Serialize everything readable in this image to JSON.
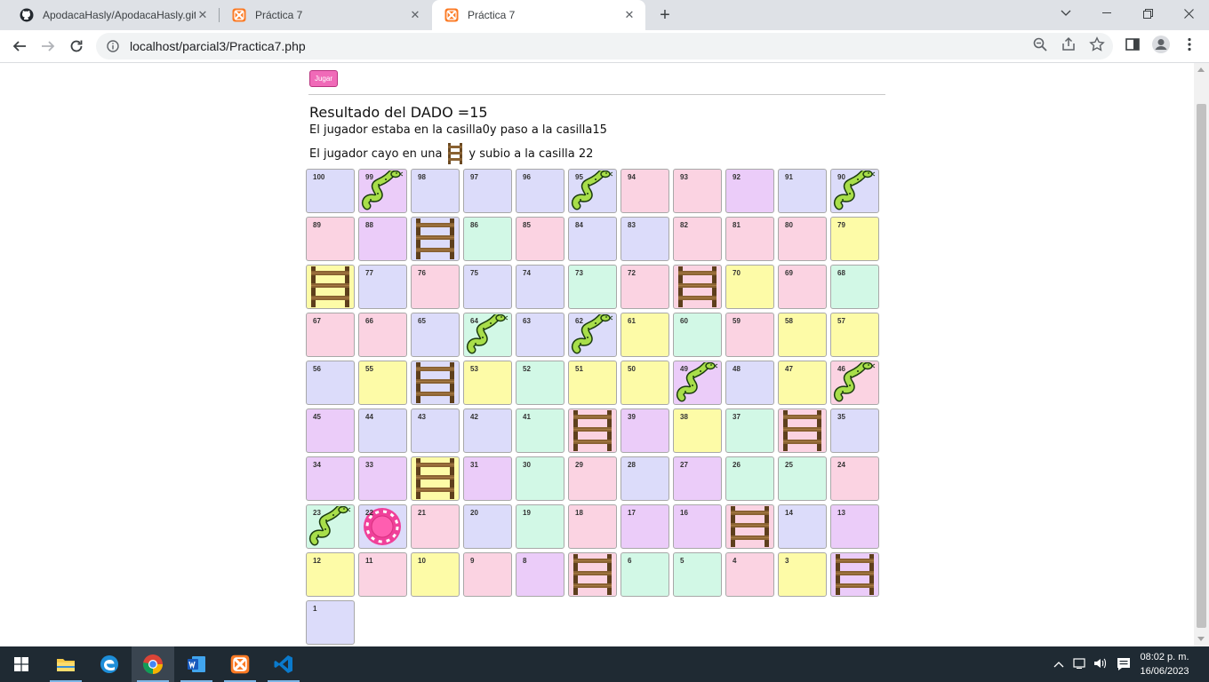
{
  "browser": {
    "tabs": [
      {
        "title": "ApodacaHasly/ApodacaHasly.git",
        "icon": "github-icon",
        "active": false
      },
      {
        "title": "Práctica 7",
        "icon": "xampp-icon",
        "active": false
      },
      {
        "title": "Práctica 7",
        "icon": "xampp-icon",
        "active": true
      }
    ],
    "url": "localhost/parcial3/Practica7.php"
  },
  "page": {
    "button_label": "Jugar",
    "result_heading": "Resultado del DADO =15",
    "move_text": "El jugador estaba en la casilla0y paso a la casilla15",
    "ladder_text_before": "El jugador cayo en una",
    "ladder_text_after": "y subio a la casilla 22"
  },
  "colors": {
    "lavender": "#dcdcfa",
    "pink": "#fbd3e2",
    "purple": "#ebccf9",
    "mint": "#d2f8e6",
    "yellow": "#fdfba7",
    "button": "#f06ab8",
    "token": "#f0409a"
  },
  "board": {
    "rows": [
      [
        {
          "n": "100",
          "c": "lavender"
        },
        {
          "n": "99",
          "c": "purple",
          "a": "snake"
        },
        {
          "n": "98",
          "c": "lavender"
        },
        {
          "n": "97",
          "c": "lavender"
        },
        {
          "n": "96",
          "c": "lavender"
        },
        {
          "n": "95",
          "c": "lavender",
          "a": "snake"
        },
        {
          "n": "94",
          "c": "pink"
        },
        {
          "n": "93",
          "c": "pink"
        },
        {
          "n": "92",
          "c": "purple"
        },
        {
          "n": "91",
          "c": "lavender"
        },
        {
          "n": "90",
          "c": "lavender",
          "a": "snake"
        }
      ],
      [
        {
          "n": "89",
          "c": "pink"
        },
        {
          "n": "88",
          "c": "purple"
        },
        {
          "n": "",
          "c": "lavender",
          "a": "ladder"
        },
        {
          "n": "86",
          "c": "mint"
        },
        {
          "n": "85",
          "c": "pink"
        },
        {
          "n": "84",
          "c": "lavender"
        },
        {
          "n": "83",
          "c": "lavender"
        },
        {
          "n": "82",
          "c": "pink"
        },
        {
          "n": "81",
          "c": "pink"
        },
        {
          "n": "80",
          "c": "pink"
        },
        {
          "n": "79",
          "c": "yellow"
        }
      ],
      [
        {
          "n": "",
          "c": "yellow",
          "a": "ladder"
        },
        {
          "n": "77",
          "c": "lavender"
        },
        {
          "n": "76",
          "c": "pink"
        },
        {
          "n": "75",
          "c": "lavender"
        },
        {
          "n": "74",
          "c": "lavender"
        },
        {
          "n": "73",
          "c": "mint"
        },
        {
          "n": "72",
          "c": "pink"
        },
        {
          "n": "",
          "c": "pink",
          "a": "ladder"
        },
        {
          "n": "70",
          "c": "yellow"
        },
        {
          "n": "69",
          "c": "pink"
        },
        {
          "n": "68",
          "c": "mint"
        }
      ],
      [
        {
          "n": "67",
          "c": "pink"
        },
        {
          "n": "66",
          "c": "pink"
        },
        {
          "n": "65",
          "c": "lavender"
        },
        {
          "n": "64",
          "c": "mint",
          "a": "snake"
        },
        {
          "n": "63",
          "c": "lavender"
        },
        {
          "n": "62",
          "c": "lavender",
          "a": "snake"
        },
        {
          "n": "61",
          "c": "yellow"
        },
        {
          "n": "60",
          "c": "mint"
        },
        {
          "n": "59",
          "c": "pink"
        },
        {
          "n": "58",
          "c": "yellow"
        },
        {
          "n": "57",
          "c": "yellow"
        }
      ],
      [
        {
          "n": "56",
          "c": "lavender"
        },
        {
          "n": "55",
          "c": "yellow"
        },
        {
          "n": "",
          "c": "lavender",
          "a": "ladder"
        },
        {
          "n": "53",
          "c": "yellow"
        },
        {
          "n": "52",
          "c": "mint"
        },
        {
          "n": "51",
          "c": "yellow"
        },
        {
          "n": "50",
          "c": "yellow"
        },
        {
          "n": "49",
          "c": "purple",
          "a": "snake"
        },
        {
          "n": "48",
          "c": "lavender"
        },
        {
          "n": "47",
          "c": "yellow"
        },
        {
          "n": "46",
          "c": "pink",
          "a": "snake"
        }
      ],
      [
        {
          "n": "45",
          "c": "purple"
        },
        {
          "n": "44",
          "c": "lavender"
        },
        {
          "n": "43",
          "c": "lavender"
        },
        {
          "n": "42",
          "c": "lavender"
        },
        {
          "n": "41",
          "c": "mint"
        },
        {
          "n": "",
          "c": "pink",
          "a": "ladder"
        },
        {
          "n": "39",
          "c": "purple"
        },
        {
          "n": "38",
          "c": "yellow"
        },
        {
          "n": "37",
          "c": "mint"
        },
        {
          "n": "",
          "c": "pink",
          "a": "ladder"
        },
        {
          "n": "35",
          "c": "lavender"
        }
      ],
      [
        {
          "n": "34",
          "c": "purple"
        },
        {
          "n": "33",
          "c": "purple"
        },
        {
          "n": "",
          "c": "yellow",
          "a": "ladder"
        },
        {
          "n": "31",
          "c": "purple"
        },
        {
          "n": "30",
          "c": "mint"
        },
        {
          "n": "29",
          "c": "pink"
        },
        {
          "n": "28",
          "c": "lavender"
        },
        {
          "n": "27",
          "c": "purple"
        },
        {
          "n": "26",
          "c": "mint"
        },
        {
          "n": "25",
          "c": "mint"
        },
        {
          "n": "24",
          "c": "pink"
        }
      ],
      [
        {
          "n": "23",
          "c": "mint",
          "a": "snake"
        },
        {
          "n": "22",
          "c": "lavender",
          "a": "token"
        },
        {
          "n": "21",
          "c": "pink"
        },
        {
          "n": "20",
          "c": "lavender"
        },
        {
          "n": "19",
          "c": "mint"
        },
        {
          "n": "18",
          "c": "pink"
        },
        {
          "n": "17",
          "c": "purple"
        },
        {
          "n": "16",
          "c": "purple"
        },
        {
          "n": "",
          "c": "pink",
          "a": "ladder"
        },
        {
          "n": "14",
          "c": "lavender"
        },
        {
          "n": "13",
          "c": "purple"
        }
      ],
      [
        {
          "n": "12",
          "c": "yellow"
        },
        {
          "n": "11",
          "c": "pink"
        },
        {
          "n": "10",
          "c": "yellow"
        },
        {
          "n": "9",
          "c": "pink"
        },
        {
          "n": "8",
          "c": "purple"
        },
        {
          "n": "",
          "c": "pink",
          "a": "ladder"
        },
        {
          "n": "6",
          "c": "mint"
        },
        {
          "n": "5",
          "c": "mint"
        },
        {
          "n": "4",
          "c": "pink"
        },
        {
          "n": "3",
          "c": "yellow"
        },
        {
          "n": "",
          "c": "purple",
          "a": "ladder"
        }
      ],
      [
        {
          "n": "1",
          "c": "lavender"
        }
      ]
    ]
  },
  "taskbar": {
    "apps": [
      "start-icon",
      "file-explorer-icon",
      "edge-icon",
      "chrome-icon",
      "word-icon",
      "xampp-icon",
      "vscode-icon"
    ],
    "time": "08:02 p. m.",
    "date": "16/06/2023"
  }
}
